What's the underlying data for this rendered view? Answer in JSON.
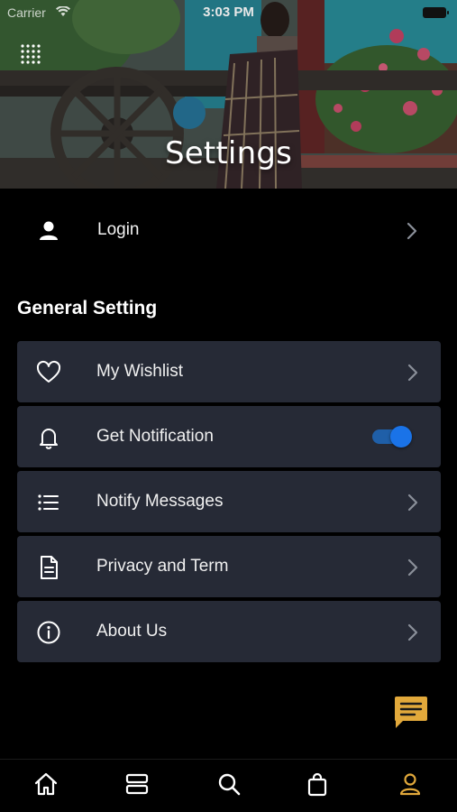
{
  "status_bar": {
    "carrier": "Carrier",
    "time": "3:03 PM"
  },
  "header": {
    "title": "Settings"
  },
  "login": {
    "label": "Login",
    "icon": "user-icon"
  },
  "general": {
    "title": "General Setting",
    "items": [
      {
        "label": "My Wishlist",
        "icon": "heart-icon",
        "control": "chevron"
      },
      {
        "label": "Get Notification",
        "icon": "bell-icon",
        "control": "toggle",
        "enabled": true
      },
      {
        "label": "Notify Messages",
        "icon": "list-icon",
        "control": "chevron"
      },
      {
        "label": "Privacy and Term",
        "icon": "document-icon",
        "control": "chevron"
      },
      {
        "label": "About Us",
        "icon": "info-icon",
        "control": "chevron"
      }
    ]
  },
  "bottom_nav": {
    "items": [
      {
        "icon": "home-icon",
        "active": false
      },
      {
        "icon": "categories-icon",
        "active": false
      },
      {
        "icon": "search-icon",
        "active": false
      },
      {
        "icon": "bag-icon",
        "active": false
      },
      {
        "icon": "profile-icon",
        "active": true
      }
    ]
  },
  "colors": {
    "background": "#000000",
    "card": "#262a36",
    "accent_active": "#e2a93b",
    "toggle_on": "#1a73e8",
    "chevron": "#8a8f99"
  }
}
